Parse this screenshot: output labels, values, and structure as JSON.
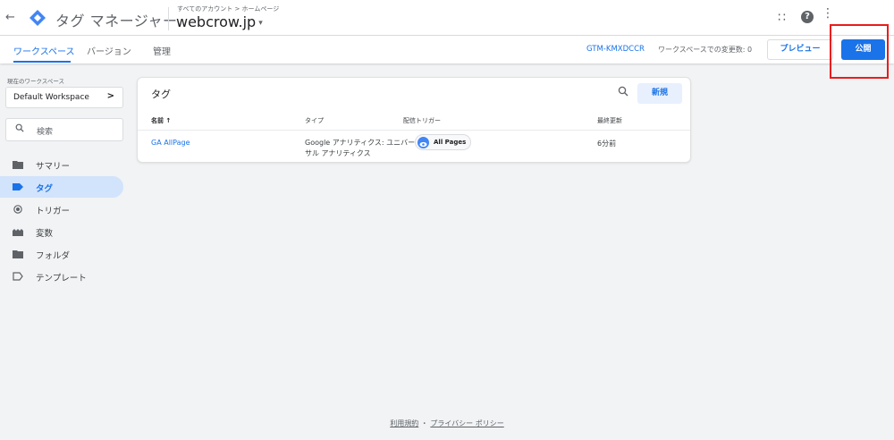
{
  "header": {
    "back_glyph": "←",
    "app_title": "タグ マネージャー",
    "breadcrumb": "すべてのアカウント > ホームページ",
    "container_name": "webcrow.jp",
    "container_caret": "▾",
    "help_glyph": "?",
    "apps_glyph": "∷",
    "more_glyph": "⋮"
  },
  "subbar": {
    "tabs": [
      {
        "label": "ワークスペース"
      },
      {
        "label": "バージョン"
      },
      {
        "label": "管理"
      }
    ],
    "container_id": "GTM-KMXDCCR",
    "changes_text": "ワークスペースでの変更数: 0",
    "preview_label": "プレビュー",
    "publish_label": "公開"
  },
  "sidebar": {
    "workspace_label": "現在のワークスペース",
    "workspace_name": "Default Workspace",
    "workspace_chevron": ">",
    "search_placeholder": "検索",
    "items": [
      {
        "label": "サマリー",
        "icon": "folder-icon"
      },
      {
        "label": "タグ",
        "icon": "tag-icon"
      },
      {
        "label": "トリガー",
        "icon": "trigger-icon"
      },
      {
        "label": "変数",
        "icon": "variable-icon"
      },
      {
        "label": "フォルダ",
        "icon": "folder-icon"
      },
      {
        "label": "テンプレート",
        "icon": "template-icon"
      }
    ],
    "active_index": 1
  },
  "tags_card": {
    "title": "タグ",
    "new_button_label": "新規",
    "columns": [
      "名前 ↑",
      "タイプ",
      "配信トリガー",
      "最終更新"
    ],
    "rows": [
      {
        "name": "GA AllPage",
        "type": "Google アナリティクス: ユニバーサル アナリティクス",
        "trigger": "All Pages",
        "updated": "6分前"
      }
    ]
  },
  "footer": {
    "terms": "利用規約",
    "separator": "・",
    "privacy": "プライバシー ポリシー"
  },
  "colors": {
    "accent": "#1a73e8",
    "highlight": "#ea1c1c",
    "active_nav_bg": "#d2e3fc"
  }
}
